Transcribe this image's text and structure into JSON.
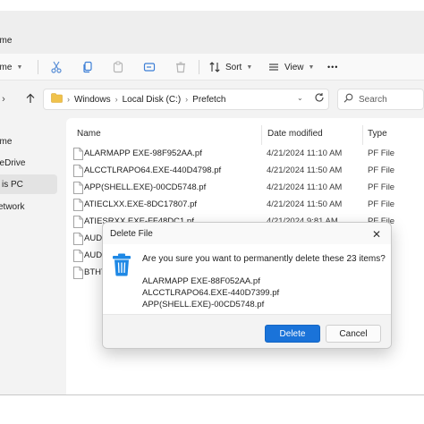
{
  "window": {
    "tab_title": "ome"
  },
  "toolbar": {
    "new_label": "ome",
    "sort_label": "Sort",
    "view_label": "View",
    "more_label": "•••"
  },
  "address": {
    "crumbs": [
      "Windows",
      "Local Disk (C:)",
      "Prefetch"
    ],
    "search_placeholder": "Search"
  },
  "nav": {
    "items": [
      {
        "label": "ome"
      },
      {
        "label": "neDrive"
      },
      {
        "label": "is PC"
      },
      {
        "label": "etwork"
      }
    ]
  },
  "columns": {
    "name": "Name",
    "date": "Date modified",
    "type": "Type"
  },
  "files": [
    {
      "name": "ALARMAPP EXE-98F952AA.pf",
      "date": "4/21/2024 11:10 AM",
      "type": "PF File"
    },
    {
      "name": "ALCCTLRAPO64.EXE-440D4798.pf",
      "date": "4/21/2024 11:50 AM",
      "type": "PF File"
    },
    {
      "name": "APP(SHELL.EXE)-00CD5748.pf",
      "date": "4/21/2024 11:10 AM",
      "type": "PF File"
    },
    {
      "name": "ATIECLXX.EXE-8DC17807.pf",
      "date": "4/21/2024 11:50 AM",
      "type": "PF File"
    },
    {
      "name": "ATIESRXX.EXE-FF48DC1.pf",
      "date": "4/21/2024 9:81 AM",
      "type": "PF File"
    },
    {
      "name": "AUD",
      "date": "",
      "type": ""
    },
    {
      "name": "AUD",
      "date": "",
      "type": ""
    },
    {
      "name": "BTHT",
      "date": "",
      "type": ""
    }
  ],
  "dialog": {
    "title": "Delete File",
    "question": "Are you sure you want to permanently delete these 23 items?",
    "files": [
      "ALARMAPP EXE-88F052AA.pf",
      "ALCCTLRAPO64.EXE-440D7399.pf",
      "APP(SHELL.EXE)-00CD5748.pf"
    ],
    "delete_label": "Delete",
    "cancel_label": "Cancel"
  },
  "colors": {
    "accent": "#1a73d9",
    "folder": "#f0c24b",
    "recycle_bin": "#1e88e5"
  },
  "icons": [
    "cut-icon",
    "copy-icon",
    "paste-icon",
    "rename-icon",
    "share-icon",
    "delete-icon",
    "sort-icon",
    "view-icon",
    "more-icon",
    "up-arrow-icon",
    "folder-icon",
    "refresh-icon",
    "search-icon",
    "file-icon",
    "recycle-bin-icon",
    "close-icon"
  ]
}
